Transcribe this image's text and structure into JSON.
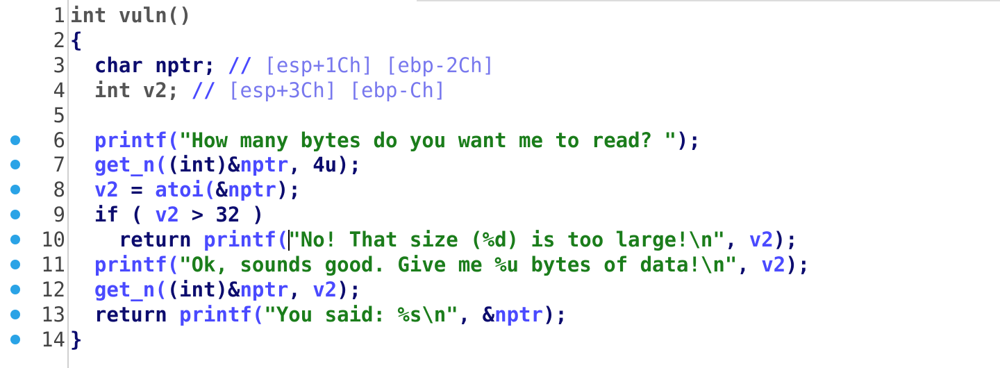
{
  "editor": {
    "lines": [
      {
        "num": "1",
        "breakpoint": false,
        "parts": [
          [
            "int vuln()",
            "typ"
          ]
        ]
      },
      {
        "num": "2",
        "breakpoint": false,
        "parts": [
          [
            "{",
            "kw"
          ]
        ]
      },
      {
        "num": "3",
        "breakpoint": false,
        "parts": [
          [
            "  char nptr; ",
            "kw"
          ],
          [
            "// ",
            "var"
          ],
          [
            "[esp+1Ch] [ebp-2Ch]",
            "cmt"
          ]
        ]
      },
      {
        "num": "4",
        "breakpoint": false,
        "parts": [
          [
            "  int v2; ",
            "typ"
          ],
          [
            "// ",
            "var"
          ],
          [
            "[esp+3Ch] [ebp-Ch]",
            "cmt"
          ]
        ]
      },
      {
        "num": "5",
        "breakpoint": false,
        "parts": []
      },
      {
        "num": "6",
        "breakpoint": true,
        "parts": [
          [
            "  printf(",
            "var"
          ],
          [
            "\"How many bytes do you want me to read? \"",
            "str"
          ],
          [
            ");",
            "kw"
          ]
        ]
      },
      {
        "num": "7",
        "breakpoint": true,
        "parts": [
          [
            "  get_n(",
            "var"
          ],
          [
            "(int)&",
            "kw"
          ],
          [
            "nptr",
            "var"
          ],
          [
            ", 4u);",
            "kw"
          ]
        ]
      },
      {
        "num": "8",
        "breakpoint": true,
        "parts": [
          [
            "  v2",
            "var"
          ],
          [
            " = ",
            "kw"
          ],
          [
            "atoi(",
            "var"
          ],
          [
            "&",
            "kw"
          ],
          [
            "nptr",
            "var"
          ],
          [
            ");",
            "kw"
          ]
        ]
      },
      {
        "num": "9",
        "breakpoint": true,
        "parts": [
          [
            "  if ( ",
            "kw"
          ],
          [
            "v2",
            "var"
          ],
          [
            " > 32 )",
            "kw"
          ]
        ]
      },
      {
        "num": "10",
        "breakpoint": true,
        "parts": [
          [
            "    return ",
            "kw"
          ],
          [
            "printf(",
            "var"
          ],
          [
            "|CURSOR|",
            "cursor"
          ],
          [
            "\"No! That size (%d) is too large!\\n\"",
            "str"
          ],
          [
            ", ",
            "kw"
          ],
          [
            "v2",
            "var"
          ],
          [
            ");",
            "kw"
          ]
        ]
      },
      {
        "num": "11",
        "breakpoint": true,
        "parts": [
          [
            "  printf(",
            "var"
          ],
          [
            "\"Ok, sounds good. Give me %u bytes of data!\\n\"",
            "str"
          ],
          [
            ", ",
            "kw"
          ],
          [
            "v2",
            "var"
          ],
          [
            ");",
            "kw"
          ]
        ]
      },
      {
        "num": "12",
        "breakpoint": true,
        "parts": [
          [
            "  get_n(",
            "var"
          ],
          [
            "(int)&",
            "kw"
          ],
          [
            "nptr",
            "var"
          ],
          [
            ", ",
            "kw"
          ],
          [
            "v2",
            "var"
          ],
          [
            ");",
            "kw"
          ]
        ]
      },
      {
        "num": "13",
        "breakpoint": true,
        "parts": [
          [
            "  return ",
            "kw"
          ],
          [
            "printf(",
            "var"
          ],
          [
            "\"You said: %s\\n\"",
            "str"
          ],
          [
            ", &",
            "kw"
          ],
          [
            "nptr",
            "var"
          ],
          [
            ");",
            "kw"
          ]
        ]
      },
      {
        "num": "14",
        "breakpoint": true,
        "parts": [
          [
            "}",
            "kw"
          ]
        ]
      }
    ],
    "colors": {
      "keyword": "#0c0c6e",
      "identifier": "#4a4aff",
      "string": "#1b7d1b",
      "comment": "#7878ee",
      "breakpoint": "#2aa3e6"
    }
  }
}
